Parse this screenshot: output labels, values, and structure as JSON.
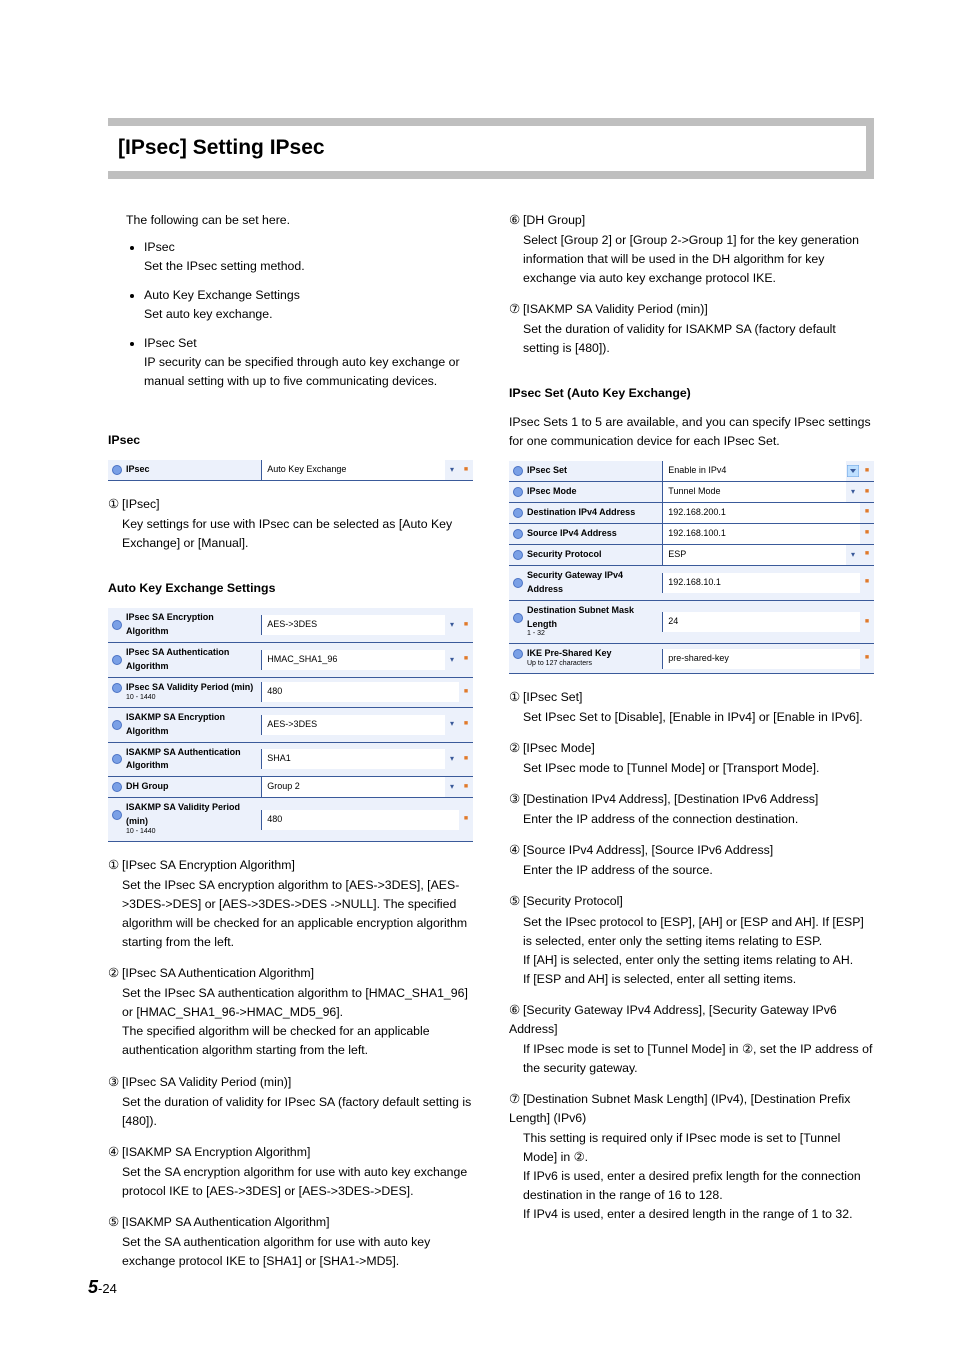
{
  "title": "[IPsec] Setting IPsec",
  "intro": {
    "lead": "The following can be set here.",
    "items": [
      {
        "head": "IPsec",
        "body": "Set the IPsec setting method."
      },
      {
        "head": "Auto Key Exchange Settings",
        "body": "Set auto key exchange."
      },
      {
        "head": "IPsec Set",
        "body": "IP security can be specified through auto key exchange or manual setting with up to five communicating devices."
      }
    ]
  },
  "left": {
    "section1": "IPsec",
    "table1": {
      "rows": [
        {
          "label": "IPsec",
          "value": "Auto Key Exchange",
          "tri": true,
          "sq": true
        }
      ]
    },
    "list1": [
      {
        "num": "①",
        "label": "[IPsec]",
        "desc": "Key settings for use with IPsec can be selected as [Auto Key Exchange] or [Manual]."
      }
    ],
    "section2": "Auto Key Exchange Settings",
    "table2": {
      "rows": [
        {
          "label": "IPsec SA Encryption Algorithm",
          "value": "AES->3DES",
          "tri": true,
          "sq": true
        },
        {
          "label": "IPsec SA Authentication Algorithm",
          "value": "HMAC_SHA1_96",
          "tri": true,
          "sq": true
        },
        {
          "label": "IPsec SA Validity Period (min)",
          "sub": "10 - 1440",
          "value": "480",
          "sq": true
        },
        {
          "label": "ISAKMP SA Encryption Algorithm",
          "value": "AES->3DES",
          "tri": true,
          "sq": true
        },
        {
          "label": "ISAKMP SA Authentication Algorithm",
          "value": "SHA1",
          "tri": true,
          "sq": true
        },
        {
          "label": "DH Group",
          "value": "Group 2",
          "tri": true,
          "sq": true
        },
        {
          "label": "ISAKMP SA Validity Period (min)",
          "sub": "10 - 1440",
          "value": "480",
          "sq": true
        }
      ]
    },
    "list2": [
      {
        "num": "①",
        "label": "[IPsec SA Encryption Algorithm]",
        "desc": "Set the IPsec SA encryption algorithm to [AES->3DES], [AES->3DES->DES] or [AES->3DES->DES ->NULL]. The specified algorithm will be checked for an applicable encryption algorithm starting from the left."
      },
      {
        "num": "②",
        "label": "[IPsec SA Authentication Algorithm]",
        "desc": "Set the IPsec SA authentication algorithm to [HMAC_SHA1_96] or [HMAC_SHA1_96->HMAC_MD5_96].\nThe specified algorithm will be checked for an applicable authentication algorithm starting from the left."
      },
      {
        "num": "③",
        "label": "[IPsec SA Validity Period (min)]",
        "desc": "Set the duration of validity for IPsec SA (factory default setting is [480])."
      },
      {
        "num": "④",
        "label": "[ISAKMP SA Encryption Algorithm]",
        "desc": "Set the SA encryption algorithm for use with auto key exchange protocol IKE to [AES->3DES] or [AES->3DES->DES]."
      },
      {
        "num": "⑤",
        "label": "[ISAKMP SA Authentication Algorithm]",
        "desc": "Set the SA authentication algorithm for use with auto key exchange protocol IKE to [SHA1] or [SHA1->MD5]."
      }
    ]
  },
  "right": {
    "list_top": [
      {
        "num": "⑥",
        "label": "[DH Group]",
        "desc": "Select [Group 2] or [Group 2->Group 1] for the key generation information that will be used in the DH algorithm for key exchange via auto key exchange protocol IKE."
      },
      {
        "num": "⑦",
        "label": "[ISAKMP SA Validity Period (min)]",
        "desc": "Set the duration of validity for ISAKMP SA (factory default setting is [480])."
      }
    ],
    "section3": "IPsec Set (Auto Key Exchange)",
    "para3": "IPsec Sets 1 to 5 are available, and you can specify IPsec settings for one communication device for each IPsec Set.",
    "table3": {
      "rows": [
        {
          "label": "IPsec Set",
          "value": "Enable in IPv4",
          "dd": true,
          "sq": true
        },
        {
          "label": "IPsec Mode",
          "value": "Tunnel Mode",
          "tri": true,
          "sq": true
        },
        {
          "label": "Destination IPv4 Address",
          "value": "192.168.200.1",
          "sq": true
        },
        {
          "label": "Source IPv4 Address",
          "value": "192.168.100.1",
          "sq": true
        },
        {
          "label": "Security Protocol",
          "value": "ESP",
          "tri": true,
          "sq": true
        },
        {
          "label": "Security Gateway IPv4 Address",
          "value": "192.168.10.1",
          "sq": true
        },
        {
          "label": "Destination Subnet Mask Length",
          "sub": "1 - 32",
          "value": "24",
          "sq": true
        },
        {
          "label": "IKE Pre-Shared Key",
          "sub": "Up to 127 characters",
          "value": "pre-shared-key",
          "sq": true
        }
      ]
    },
    "list3": [
      {
        "num": "①",
        "label": "[IPsec Set]",
        "desc": "Set IPsec Set to [Disable], [Enable in IPv4] or [Enable in IPv6]."
      },
      {
        "num": "②",
        "label": "[IPsec Mode]",
        "desc": "Set IPsec mode to [Tunnel Mode] or [Transport Mode]."
      },
      {
        "num": "③",
        "label": "[Destination IPv4 Address], [Destination IPv6 Address]",
        "desc": "Enter the IP address of the connection destination."
      },
      {
        "num": "④",
        "label": "[Source IPv4 Address], [Source IPv6 Address]",
        "desc": "Enter the IP address of the source."
      },
      {
        "num": "⑤",
        "label": "[Security Protocol]",
        "desc": "Set the IPsec protocol to [ESP], [AH] or [ESP and AH]. If [ESP] is selected, enter only the setting items relating to ESP.\nIf [AH] is selected, enter only the setting items relating to AH.\nIf [ESP and AH] is selected, enter all setting items."
      },
      {
        "num": "⑥",
        "label": "[Security Gateway IPv4 Address], [Security Gateway IPv6 Address]",
        "desc": "If IPsec mode is set to [Tunnel Mode] in ②, set the IP address of the security gateway."
      },
      {
        "num": "⑦",
        "label": "[Destination Subnet Mask Length] (IPv4), [Destination Prefix Length] (IPv6)",
        "desc": "This setting is required only if IPsec mode is set to [Tunnel Mode] in ②.\nIf IPv6 is used, enter a desired prefix length for the connection destination in the range of 16 to 128.\nIf IPv4 is used, enter a desired length in the range of 1 to 32."
      }
    ]
  },
  "footer": {
    "chapter": "5",
    "page": "-24"
  }
}
